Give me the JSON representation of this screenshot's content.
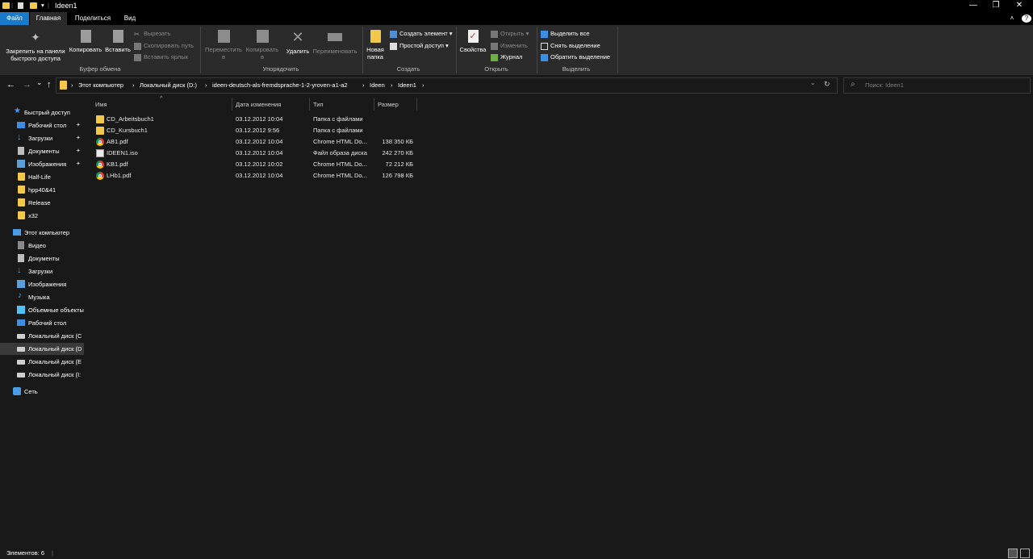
{
  "window": {
    "title": "Ideen1",
    "minimize_glyph": "—",
    "maximize_glyph": "❐",
    "close_glyph": "✕",
    "help_glyph": "?",
    "collapse_glyph": "˄",
    "quick_access_separator": "|",
    "quick_access_dropdown": "▾"
  },
  "tabs": {
    "file": "Файл",
    "home": "Главная",
    "share": "Поделиться",
    "view": "Вид"
  },
  "ribbon": {
    "clipboard": {
      "pin_label": "Закрепить на панели быстрого доступа",
      "copy_label": "Копировать",
      "paste_label": "Вставить",
      "cut_label": "Вырезать",
      "copy_path_label": "Скопировать путь",
      "paste_shortcut_label": "Вставить ярлык",
      "group_label": "Буфер обмена"
    },
    "organize": {
      "move_label": "Переместить в",
      "copyto_label": "Копировать в",
      "delete_label": "Удалить",
      "rename_label": "Переименовать",
      "group_label": "Упорядочить"
    },
    "new": {
      "new_folder_label": "Новая папка",
      "new_item_label": "Создать элемент",
      "easy_access_label": "Простой доступ",
      "group_label": "Создать"
    },
    "open": {
      "properties_label": "Свойства",
      "open_label": "Открыть",
      "edit_label": "Изменить",
      "history_label": "Журнал",
      "group_label": "Открыть"
    },
    "select": {
      "select_all_label": "Выделить все",
      "select_none_label": "Снять выделение",
      "invert_label": "Обратить выделение",
      "group_label": "Выделить"
    },
    "dropdown_glyph": "▾"
  },
  "address": {
    "back_glyph": "←",
    "forward_glyph": "→",
    "recent_glyph": "⌄",
    "up_glyph": "↑",
    "crumb_sep": "›",
    "crumbs": [
      "Этот компьютер",
      "Локальный диск (D:)",
      "ideen-deutsch-als-fremdsprache-1-2-yroven-a1-a2",
      "Ideen",
      "Ideen1"
    ],
    "dropdown_glyph": "⌄",
    "refresh_glyph": "↻",
    "search_glyph": "⌕",
    "search_placeholder": "Поиск: Ideen1"
  },
  "navpane": {
    "quick_access": "Быстрый доступ",
    "pin_glyph": "✦",
    "quick_items": [
      "Рабочий стол",
      "Загрузки",
      "Документы",
      "Изображения",
      "Half-Life",
      "hpp40&41",
      "Release",
      "x32"
    ],
    "this_pc": "Этот компьютер",
    "pc_items": [
      "Видео",
      "Документы",
      "Загрузки",
      "Изображения",
      "Музыка",
      "Объемные объекты",
      "Рабочий стол",
      "Локальный диск (C",
      "Локальный диск (D",
      "Локальный диск (E",
      "Локальный диск (I:"
    ],
    "network": "Сеть"
  },
  "filelist": {
    "sort_glyph": "^",
    "columns": {
      "name": "Имя",
      "date": "Дата изменения",
      "type": "Тип",
      "size": "Размер"
    },
    "rows": [
      {
        "name": "CD_Arbeitsbuch1",
        "date": "03.12.2012 10:04",
        "type": "Папка с файлами",
        "size": "",
        "icon": "folder"
      },
      {
        "name": "CD_Kursbuch1",
        "date": "03.12.2012 9:56",
        "type": "Папка с файлами",
        "size": "",
        "icon": "folder"
      },
      {
        "name": "AB1.pdf",
        "date": "03.12.2012 10:04",
        "type": "Chrome HTML Do...",
        "size": "138 350 КБ",
        "icon": "chrome"
      },
      {
        "name": "IDEEN1.iso",
        "date": "03.12.2012 10:04",
        "type": "Файл образа диска",
        "size": "242 270 КБ",
        "icon": "iso"
      },
      {
        "name": "KB1.pdf",
        "date": "03.12.2012 10:02",
        "type": "Chrome HTML Do...",
        "size": "72 212 КБ",
        "icon": "chrome"
      },
      {
        "name": "LHb1.pdf",
        "date": "03.12.2012 10:04",
        "type": "Chrome HTML Do...",
        "size": "126 798 КБ",
        "icon": "chrome"
      }
    ]
  },
  "status": {
    "items_count": "Элементов: 6",
    "separator": "|"
  },
  "colors": {
    "accent": "#1979ca",
    "folder": "#f1c84b",
    "background": "#191919",
    "ribbon": "#2b2b2b"
  }
}
